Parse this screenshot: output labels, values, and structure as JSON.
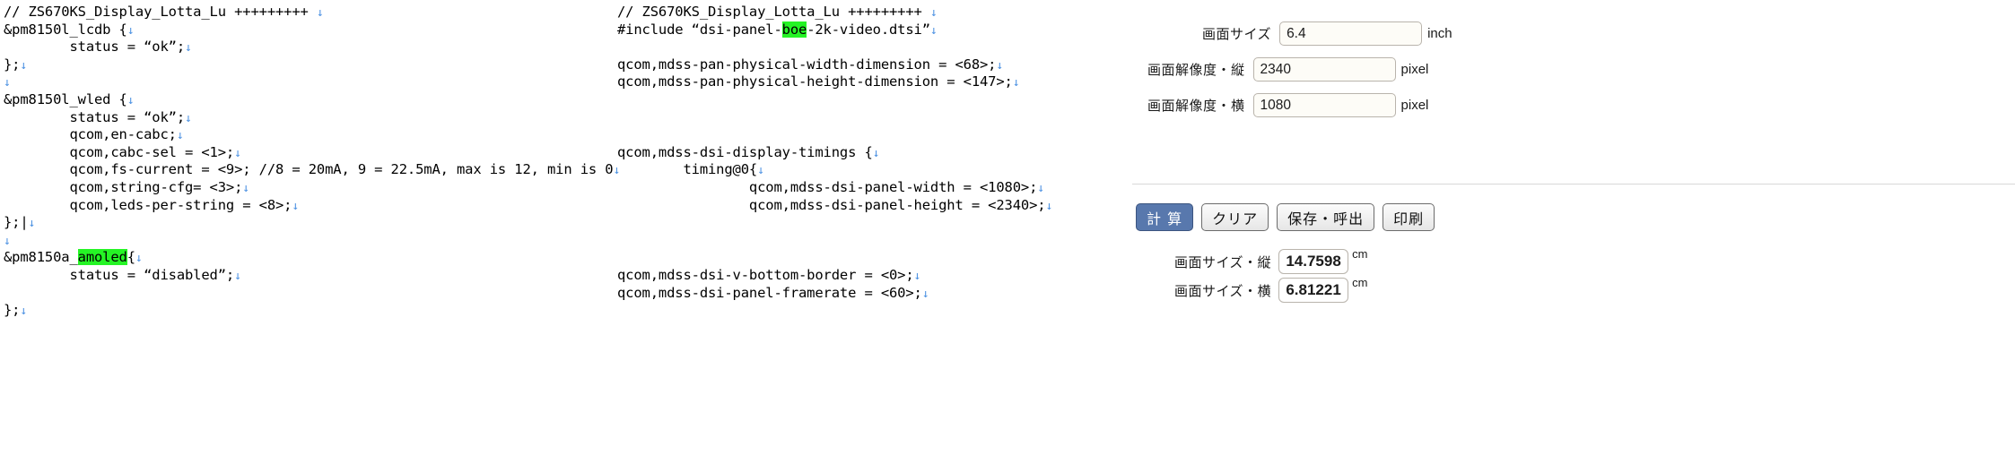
{
  "code_left": {
    "lines": [
      [
        {
          "t": "// ZS670KS_Display_Lotta_Lu +++++++++ "
        },
        {
          "t": "↓",
          "k": "eol"
        }
      ],
      [
        {
          "t": "&pm8150l_lcdb {"
        },
        {
          "t": "↓",
          "k": "eol"
        }
      ],
      [
        {
          "t": "        status = “ok”;"
        },
        {
          "t": "↓",
          "k": "eol"
        }
      ],
      [
        {
          "t": "};"
        },
        {
          "t": "↓",
          "k": "eol"
        }
      ],
      [
        {
          "t": "↓",
          "k": "eol"
        }
      ],
      [
        {
          "t": "&pm8150l_wled {"
        },
        {
          "t": "↓",
          "k": "eol"
        }
      ],
      [
        {
          "t": "        status = “ok”;"
        },
        {
          "t": "↓",
          "k": "eol"
        }
      ],
      [
        {
          "t": "        qcom,en-cabc;"
        },
        {
          "t": "↓",
          "k": "eol"
        }
      ],
      [
        {
          "t": "        qcom,cabc-sel = <1>;"
        },
        {
          "t": "↓",
          "k": "eol"
        }
      ],
      [
        {
          "t": "        qcom,fs-current = <9>; //8 = 20mA, 9 = 22.5mA, max is 12, min is 0"
        },
        {
          "t": "↓",
          "k": "eol"
        }
      ],
      [
        {
          "t": "        qcom,string-cfg= <3>;"
        },
        {
          "t": "↓",
          "k": "eol"
        }
      ],
      [
        {
          "t": "        qcom,leds-per-string = <8>;"
        },
        {
          "t": "↓",
          "k": "eol"
        }
      ],
      [
        {
          "t": "};|"
        },
        {
          "t": "↓",
          "k": "eol"
        }
      ],
      [
        {
          "t": "↓",
          "k": "eol"
        }
      ],
      [
        {
          "t": "&pm8150a_"
        },
        {
          "t": "amoled",
          "k": "hl"
        },
        {
          "t": "{"
        },
        {
          "t": "↓",
          "k": "eol"
        }
      ],
      [
        {
          "t": "        status = “disabled”;"
        },
        {
          "t": "↓",
          "k": "eol"
        }
      ],
      [
        {
          "t": ""
        }
      ],
      [
        {
          "t": "};"
        },
        {
          "t": "↓",
          "k": "eol"
        }
      ]
    ]
  },
  "code_mid": {
    "lines": [
      [
        {
          "t": "// ZS670KS_Display_Lotta_Lu +++++++++ "
        },
        {
          "t": "↓",
          "k": "eol"
        }
      ],
      [
        {
          "t": "#include “dsi-panel-"
        },
        {
          "t": "boe",
          "k": "hl"
        },
        {
          "t": "-2k-video.dtsi”"
        },
        {
          "t": "↓",
          "k": "eol"
        }
      ],
      [
        {
          "t": ""
        }
      ],
      [
        {
          "t": "qcom,mdss-pan-physical-width-dimension = <68>;"
        },
        {
          "t": "↓",
          "k": "eol"
        }
      ],
      [
        {
          "t": "qcom,mdss-pan-physical-height-dimension = <147>;"
        },
        {
          "t": "↓",
          "k": "eol"
        }
      ],
      [
        {
          "t": ""
        }
      ],
      [
        {
          "t": ""
        }
      ],
      [
        {
          "t": ""
        }
      ],
      [
        {
          "t": "qcom,mdss-dsi-display-timings {"
        },
        {
          "t": "↓",
          "k": "eol"
        }
      ],
      [
        {
          "t": "        timing@0{"
        },
        {
          "t": "↓",
          "k": "eol"
        }
      ],
      [
        {
          "t": "                qcom,mdss-dsi-panel-width = <1080>;"
        },
        {
          "t": "↓",
          "k": "eol"
        }
      ],
      [
        {
          "t": "                qcom,mdss-dsi-panel-height = <2340>;"
        },
        {
          "t": "↓",
          "k": "eol"
        }
      ],
      [
        {
          "t": ""
        }
      ],
      [
        {
          "t": ""
        }
      ],
      [
        {
          "t": ""
        }
      ],
      [
        {
          "t": "qcom,mdss-dsi-v-bottom-border = <0>;"
        },
        {
          "t": "↓",
          "k": "eol"
        }
      ],
      [
        {
          "t": "qcom,mdss-dsi-panel-framerate = <60>;"
        },
        {
          "t": "↓",
          "k": "eol"
        }
      ]
    ]
  },
  "panel": {
    "inputs": [
      {
        "label": "画面サイズ",
        "value": "6.4",
        "unit": "inch"
      },
      {
        "label": "画面解像度・縦",
        "value": "2340",
        "unit": "pixel"
      },
      {
        "label": "画面解像度・横",
        "value": "1080",
        "unit": "pixel"
      }
    ],
    "buttons": [
      {
        "label": "計 算",
        "style": "primary"
      },
      {
        "label": "クリア",
        "style": "normal"
      },
      {
        "label": "保存・呼出",
        "style": "normal"
      },
      {
        "label": "印刷",
        "style": "normal"
      }
    ],
    "results": [
      {
        "label": "画面サイズ・縦",
        "value": "14.7598",
        "unit": "cm"
      },
      {
        "label": "画面サイズ・横",
        "value": "6.81221",
        "unit": "cm"
      }
    ]
  },
  "colors": {
    "highlight": "#25f425",
    "eol_mark": "#4a90e2",
    "primary_button": "#5878ad"
  }
}
